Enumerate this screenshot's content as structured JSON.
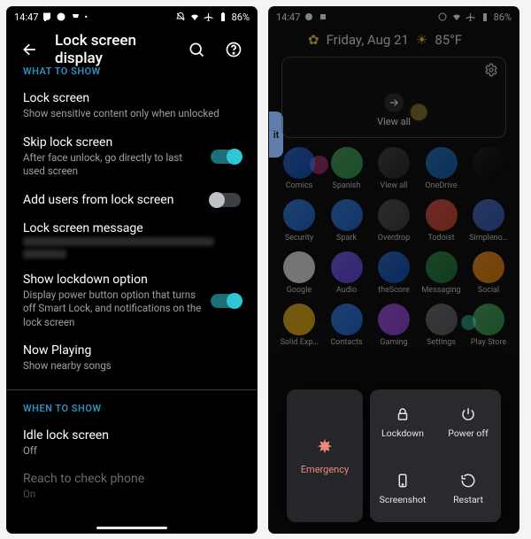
{
  "status": {
    "time": "14:47",
    "battery": "86%"
  },
  "settings": {
    "title": "Lock screen display",
    "section1": "WHAT TO SHOW",
    "section2": "WHEN TO SHOW",
    "items": {
      "lockscreen": {
        "title": "Lock screen",
        "sub": "Show sensitive content only when unlocked"
      },
      "skip": {
        "title": "Skip lock screen",
        "sub": "After face unlock, go directly to last used screen",
        "on": true
      },
      "addusers": {
        "title": "Add users from lock screen",
        "on": false
      },
      "message": {
        "title": "Lock screen message"
      },
      "lockdown": {
        "title": "Show lockdown option",
        "sub": "Display power button option that turns off Smart Lock, and notifications on the lock screen",
        "on": true
      },
      "nowplaying": {
        "title": "Now Playing",
        "sub": "Show nearby songs"
      },
      "idle": {
        "title": "Idle lock screen",
        "sub": "Off"
      },
      "reach": {
        "title": "Reach to check phone",
        "sub": "On"
      }
    }
  },
  "home": {
    "date": "Friday, Aug 21",
    "temp": "85°F",
    "viewall": "View all",
    "gtab": "it",
    "apps": [
      [
        {
          "l": "Comics",
          "c": "#0b57d0"
        },
        {
          "l": "Spanish",
          "c": "#34a853"
        },
        {
          "l": "View all",
          "c": "#2a2a2a"
        },
        {
          "l": "OneDrive",
          "c": "#0a66c2"
        },
        {
          "l": "",
          "c": "#000"
        }
      ],
      [
        {
          "l": "Security",
          "c": "#1a73e8"
        },
        {
          "l": "Spark",
          "c": "#1a73e8"
        },
        {
          "l": "Overdrop",
          "c": "#3c4043"
        },
        {
          "l": "Todoist",
          "c": "#e44332"
        },
        {
          "l": "Simpleno…",
          "c": "#3361cc"
        }
      ],
      [
        {
          "l": "Google",
          "c": "#fff"
        },
        {
          "l": "Audio",
          "c": "#6d4aff"
        },
        {
          "l": "theScore",
          "c": "#0b57d0"
        },
        {
          "l": "Messaging",
          "c": "#188038"
        },
        {
          "l": "Social",
          "c": "#ff8a00"
        }
      ],
      [
        {
          "l": "Solid Exp…",
          "c": "#fbbc04"
        },
        {
          "l": "Contacts",
          "c": "#1a73e8"
        },
        {
          "l": "Gaming",
          "c": "#a142f4"
        },
        {
          "l": "Settings",
          "c": "#5f6368"
        },
        {
          "l": "Play Store",
          "c": "#34a853"
        }
      ]
    ]
  },
  "power": {
    "emergency": "Emergency",
    "buttons": {
      "lockdown": "Lockdown",
      "poweroff": "Power off",
      "screenshot": "Screenshot",
      "restart": "Restart"
    }
  }
}
